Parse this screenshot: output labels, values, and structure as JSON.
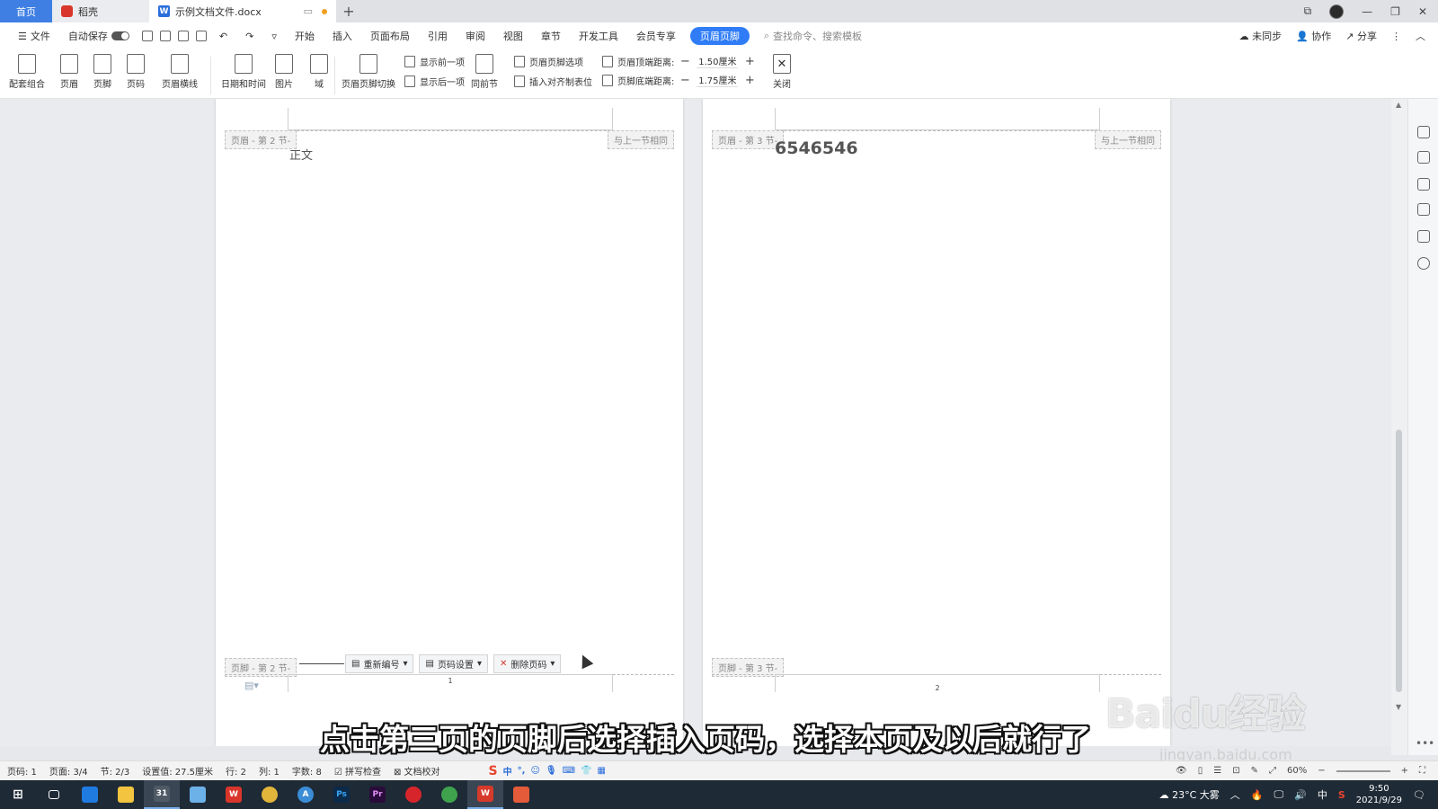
{
  "tabs": {
    "home": "首页",
    "daoke": "稻壳",
    "doc": "示例文档文件.docx"
  },
  "menubar": {
    "file": "文件",
    "autosave": "自动保存",
    "items": [
      "开始",
      "插入",
      "页面布局",
      "引用",
      "审阅",
      "视图",
      "章节",
      "开发工具",
      "会员专享"
    ],
    "active": "页眉页脚",
    "search": "查找命令、搜索模板",
    "unsynced": "未同步",
    "collab": "协作",
    "share": "分享"
  },
  "ribbon": {
    "combo": "配套组合",
    "header": "页眉",
    "footer": "页脚",
    "page_number": "页码",
    "header_line": "页眉横线",
    "datetime": "日期和时间",
    "picture": "图片",
    "field": "域",
    "switch": "页眉页脚切换",
    "show_prev": "显示前一项",
    "show_next": "显示后一项",
    "same_as_prev": "同前节",
    "hf_options": "页眉页脚选项",
    "insert_tab": "插入对齐制表位",
    "header_top_label": "页眉顶端距离:",
    "header_top_value": "1.50厘米",
    "footer_bottom_label": "页脚底端距离:",
    "footer_bottom_value": "1.75厘米",
    "close": "关闭"
  },
  "page1": {
    "header_tag": "页眉 - 第 2 节-",
    "same_tag": "与上一节相同",
    "body": "正文",
    "footer_tag": "页脚 - 第 2 节-",
    "renumber": "重新编号",
    "page_setup": "页码设置",
    "delete_num": "删除页码",
    "footer_num": "1"
  },
  "page2": {
    "header_tag": "页眉 - 第 3 节-",
    "same_tag": "与上一节相同",
    "body": "6546546",
    "footer_tag": "页脚 - 第 3 节-",
    "footer_num": "2"
  },
  "subtitle": "点击第三页的页脚后选择插入页码，选择本页及以后就行了",
  "watermark": {
    "main": "Baidu经验",
    "sub": "jingyan.baidu.com"
  },
  "status": {
    "page": "页码: 1",
    "pages": "页面: 3/4",
    "section": "节: 2/3",
    "setting": "设置值: 27.5厘米",
    "row": "行: 2",
    "col": "列: 1",
    "words": "字数: 8",
    "spell": "拼写检查",
    "proof": "文档校对",
    "zoom": "60%"
  },
  "taskbar": {
    "weather": "23°C 大雾",
    "ime": "中",
    "time": "9:50",
    "date": "2021/9/29"
  }
}
